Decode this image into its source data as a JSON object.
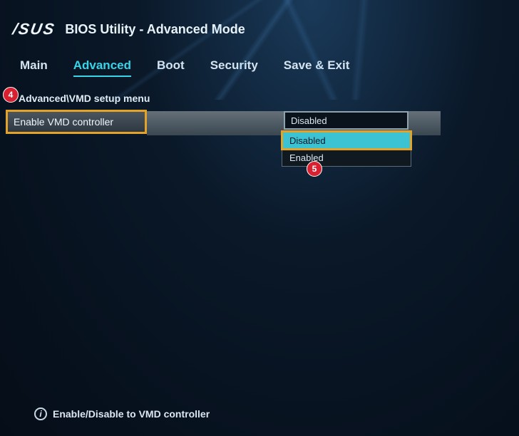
{
  "header": {
    "brand": "/SUS",
    "title": "BIOS Utility - Advanced Mode"
  },
  "tabs": {
    "items": [
      {
        "label": "Main"
      },
      {
        "label": "Advanced"
      },
      {
        "label": "Boot"
      },
      {
        "label": "Security"
      },
      {
        "label": "Save & Exit"
      }
    ],
    "activeIndex": 1
  },
  "breadcrumb": "Advanced\\VMD setup menu",
  "setting": {
    "label": "Enable VMD controller",
    "currentValue": "Disabled",
    "dropdown": {
      "options": [
        "Disabled",
        "Enabled"
      ],
      "selectedIndex": 0
    }
  },
  "annotations": {
    "a4": "4",
    "a5": "5"
  },
  "helpText": "Enable/Disable to VMD controller"
}
